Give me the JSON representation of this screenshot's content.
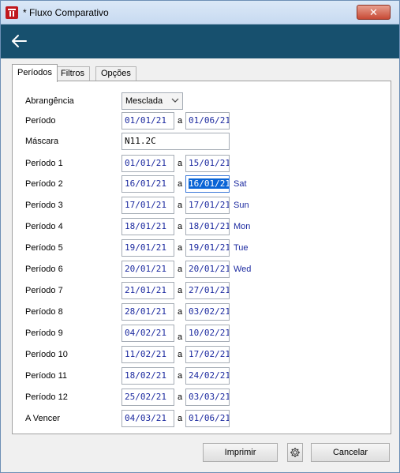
{
  "window": {
    "title": "* Fluxo Comparativo",
    "close_label": "✕"
  },
  "tabs": [
    {
      "label": "Períodos"
    },
    {
      "label": "Filtros"
    },
    {
      "label": "Opções"
    }
  ],
  "form": {
    "abrangencia": {
      "label": "Abrangência",
      "value": "Mesclada"
    },
    "periodo": {
      "label": "Período",
      "from": "01/01/21",
      "sep": "a",
      "to": "01/06/21"
    },
    "mascara": {
      "label": "Máscara",
      "value": "N11.2C"
    },
    "periods": [
      {
        "label": "Período 1",
        "from": "01/01/21",
        "sep": "a",
        "to": "15/01/21",
        "weekday": ""
      },
      {
        "label": "Período 2",
        "from": "16/01/21",
        "sep": "a",
        "to": "16/01/21",
        "weekday": "Sat"
      },
      {
        "label": "Período 3",
        "from": "17/01/21",
        "sep": "a",
        "to": "17/01/21",
        "weekday": "Sun"
      },
      {
        "label": "Período 4",
        "from": "18/01/21",
        "sep": "a",
        "to": "18/01/21",
        "weekday": "Mon"
      },
      {
        "label": "Período 5",
        "from": "19/01/21",
        "sep": "a",
        "to": "19/01/21",
        "weekday": "Tue"
      },
      {
        "label": "Período 6",
        "from": "20/01/21",
        "sep": "a",
        "to": "20/01/21",
        "weekday": "Wed"
      },
      {
        "label": "Período 7",
        "from": "21/01/21",
        "sep": "a",
        "to": "27/01/21",
        "weekday": ""
      },
      {
        "label": "Período 8",
        "from": "28/01/21",
        "sep": "a",
        "to": "03/02/21",
        "weekday": ""
      },
      {
        "label": "Período 9",
        "from": "04/02/21",
        "sep": "a",
        "to": "10/02/21",
        "weekday": ""
      },
      {
        "label": "Período 10",
        "from": "11/02/21",
        "sep": "a",
        "to": "17/02/21",
        "weekday": ""
      },
      {
        "label": "Período 11",
        "from": "18/02/21",
        "sep": "a",
        "to": "24/02/21",
        "weekday": ""
      },
      {
        "label": "Período 12",
        "from": "25/02/21",
        "sep": "a",
        "to": "03/03/21",
        "weekday": ""
      }
    ],
    "a_vencer": {
      "label": "A Vencer",
      "from": "04/03/21",
      "sep": "a",
      "to": "01/06/21"
    }
  },
  "buttons": {
    "print_label": "Imprimir",
    "cancel_label": "Cancelar"
  },
  "icons": {
    "back": "arrow-left-icon",
    "settings": "gear-icon",
    "dropdown": "chevron-down-icon",
    "app": "app-logo-icon"
  },
  "colors": {
    "toolbar": "#17506e",
    "field_text": "#1c2aa0",
    "selection": "#0a64d6"
  }
}
